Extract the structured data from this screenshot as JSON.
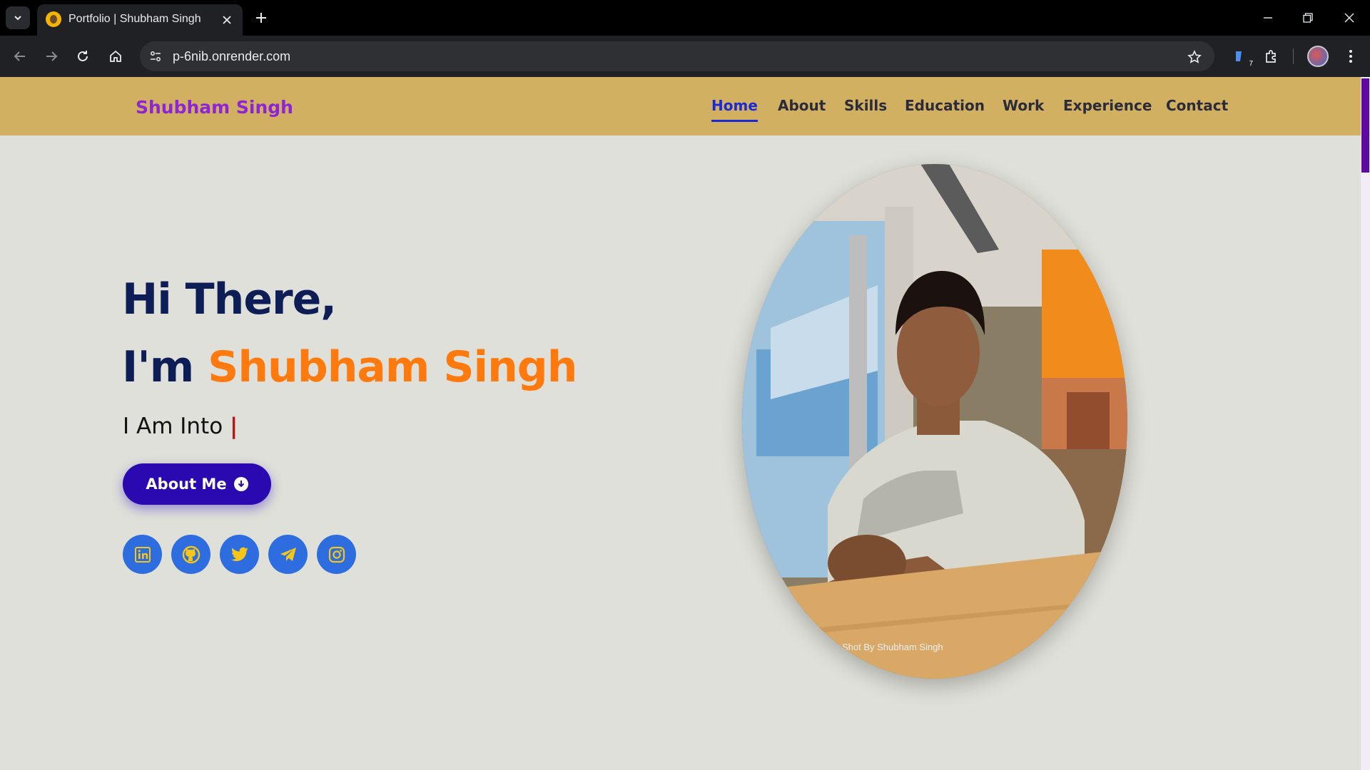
{
  "browser": {
    "tab_title": "Portfolio | Shubham Singh",
    "url": "p-6nib.onrender.com",
    "extension_badge": "7"
  },
  "site": {
    "brand": "Shubham Singh",
    "nav": [
      {
        "label": "Home",
        "active": true
      },
      {
        "label": "About"
      },
      {
        "label": "Skills"
      },
      {
        "label": "Education"
      },
      {
        "label": "Work"
      },
      {
        "label": "Experience"
      },
      {
        "label": "Contact"
      }
    ]
  },
  "hero": {
    "greeting": "Hi There,",
    "im": "I'm ",
    "name": "Shubham Singh",
    "into": "I Am Into ",
    "caret": "|",
    "button_label": "About Me",
    "socials": [
      "linkedin-icon",
      "github-icon",
      "twitter-icon",
      "telegram-icon",
      "instagram-icon"
    ],
    "photo_watermark": "Shot By Shubham Singh"
  },
  "colors": {
    "header_bg": "#d1b062",
    "brand": "#8e24d6",
    "nav_active": "#1b2ad6",
    "name_orange": "#ff7a0e",
    "heading_navy": "#0d1d56",
    "button_bg": "#2a0ab0",
    "social_bg": "#2d6de0",
    "social_icon": "#f5c518"
  }
}
